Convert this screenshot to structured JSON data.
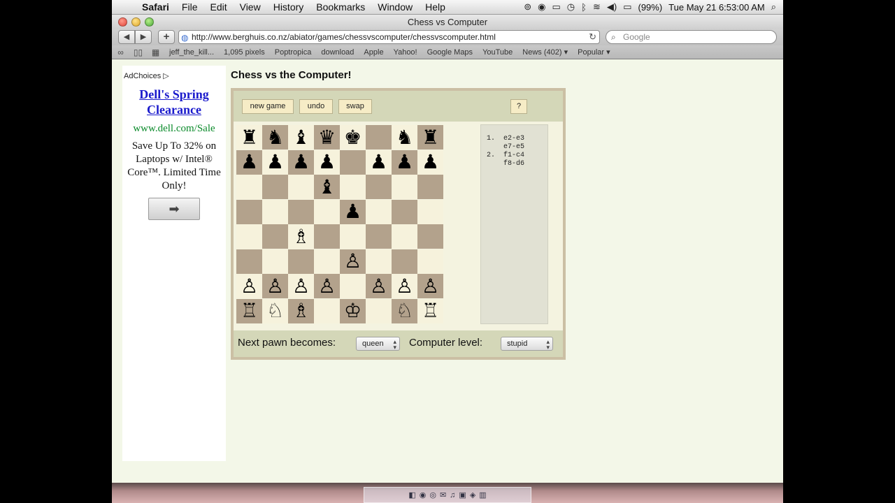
{
  "menubar": {
    "apple": "",
    "app": "Safari",
    "items": [
      "File",
      "Edit",
      "View",
      "History",
      "Bookmarks",
      "Window",
      "Help"
    ],
    "battery": "(99%)",
    "clock": "Tue May 21  6:53:00 AM"
  },
  "window": {
    "title": "Chess vs Computer",
    "url": "http://www.berghuis.co.nz/abiator/games/chessvscomputer/chessvscomputer.html",
    "search_placeholder": "Google"
  },
  "bookmarks": [
    "jeff_the_kill...",
    "1,095 pixels",
    "Poptropica",
    "download",
    "Apple",
    "Yahoo!",
    "Google Maps",
    "YouTube",
    "News (402) ▾",
    "Popular ▾"
  ],
  "ad": {
    "choices": "AdChoices ▷",
    "title": "Dell's Spring Clearance",
    "url": "www.dell.com/Sale",
    "text": "Save Up To 32% on Laptops w/ Intel® Core™. Limited Time Only!",
    "button": "➡"
  },
  "game": {
    "title": "Chess vs the Computer!",
    "buttons": {
      "new_game": "new game",
      "undo": "undo",
      "swap": "swap",
      "help": "?"
    },
    "moves": "1.  e2-e3\n    e7-e5\n2.  f1-c4\n    f8-d6",
    "pawn_label": "Next pawn becomes:",
    "pawn_value": "queen",
    "level_label": "Computer level:",
    "level_value": "stupid",
    "board": [
      [
        "♜",
        "♞",
        "♝",
        "♛",
        "♚",
        "",
        "♞",
        "♜"
      ],
      [
        "♟",
        "♟",
        "♟",
        "♟",
        "",
        "♟",
        "♟",
        "♟"
      ],
      [
        "",
        "",
        "",
        "♝",
        "",
        "",
        "",
        ""
      ],
      [
        "",
        "",
        "",
        "",
        "♟",
        "",
        "",
        ""
      ],
      [
        "",
        "",
        "♗",
        "",
        "",
        "",
        "",
        ""
      ],
      [
        "",
        "",
        "",
        "",
        "♙",
        "",
        "",
        ""
      ],
      [
        "♙",
        "♙",
        "♙",
        "♙",
        "",
        "♙",
        "♙",
        "♙"
      ],
      [
        "♖",
        "♘",
        "♗",
        "",
        "♔",
        "",
        "♘",
        "♖"
      ]
    ]
  }
}
